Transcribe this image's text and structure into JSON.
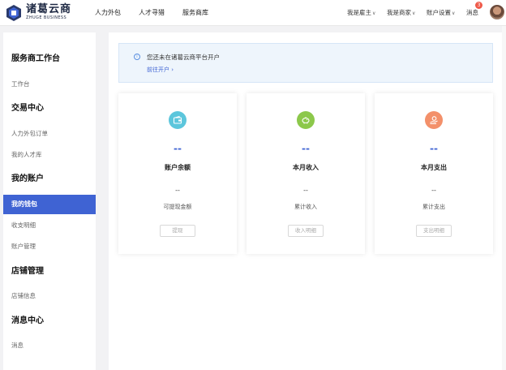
{
  "header": {
    "logo_cn": "诸葛云商",
    "logo_en": "ZHUGE BUSINESS",
    "nav": [
      "人力外包",
      "人才寻猎",
      "服务商库"
    ],
    "right_menu": [
      "我是雇主",
      "我是商家",
      "账户设置"
    ],
    "messages_label": "消息",
    "messages_badge": "3"
  },
  "sidebar": {
    "groups": [
      {
        "title": "服务商工作台",
        "items": [
          "工作台"
        ]
      },
      {
        "title": "交易中心",
        "items": [
          "人力外包订单",
          "我的人才库"
        ]
      },
      {
        "title": "我的账户",
        "items": [
          "我的钱包",
          "收支明细",
          "账户管理"
        ]
      },
      {
        "title": "店铺管理",
        "items": [
          "店铺信息"
        ]
      },
      {
        "title": "消息中心",
        "items": [
          "消息"
        ]
      }
    ],
    "active_item": "我的钱包"
  },
  "notice": {
    "text": "您还未在诸葛云商平台开户",
    "link": "前往开户",
    "link_arrow": "›"
  },
  "cards": [
    {
      "main_value": "--",
      "title": "账户余额",
      "sub_value": "--",
      "sub_label": "可提现金额",
      "button": "提现",
      "icon": "wallet-icon",
      "icon_color": "#5cc6dc"
    },
    {
      "main_value": "--",
      "title": "本月收入",
      "sub_value": "--",
      "sub_label": "累计收入",
      "button": "收入明细",
      "icon": "piggy-bank-icon",
      "icon_color": "#8cc84b"
    },
    {
      "main_value": "--",
      "title": "本月支出",
      "sub_value": "--",
      "sub_label": "累计支出",
      "button": "支出明细",
      "icon": "payment-hand-icon",
      "icon_color": "#f3906a"
    }
  ],
  "colors": {
    "accent": "#3f63d3",
    "notice_bg": "#eef5fc",
    "badge": "#ef5a4a"
  }
}
